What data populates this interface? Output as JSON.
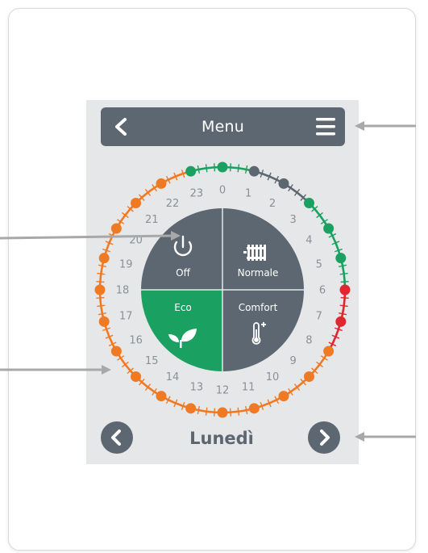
{
  "header": {
    "title": "Menu",
    "back_icon": "chevron-left-icon",
    "menu_icon": "hamburger-menu-icon"
  },
  "dial": {
    "hours": [
      "0",
      "1",
      "2",
      "3",
      "4",
      "5",
      "6",
      "7",
      "8",
      "9",
      "10",
      "11",
      "12",
      "13",
      "14",
      "15",
      "16",
      "17",
      "18",
      "19",
      "20",
      "21",
      "22",
      "23"
    ],
    "modes": [
      "normal",
      "off",
      "off",
      "normal",
      "normal",
      "normal",
      "comfort",
      "comfort",
      "eco",
      "eco",
      "eco",
      "eco",
      "eco",
      "eco",
      "eco",
      "eco",
      "eco",
      "eco",
      "eco",
      "eco",
      "eco",
      "eco",
      "eco",
      "normal"
    ],
    "mode_colors": {
      "normal": "#1aa162",
      "off": "#5d6771",
      "comfort": "#e0262e",
      "eco": "#f07a24"
    }
  },
  "mode_buttons": {
    "off": {
      "label": "Off",
      "icon": "power-icon",
      "color": "#5d6771"
    },
    "normal": {
      "label": "Normale",
      "icon": "radiator-icon",
      "color": "#5d6771"
    },
    "eco": {
      "label": "Eco",
      "icon": "leaf-icon",
      "color": "#1aa162"
    },
    "comfort": {
      "label": "Comfort",
      "icon": "thermometer-plus-icon",
      "color": "#5d6771"
    }
  },
  "day_nav": {
    "day": "Lunedì",
    "prev_icon": "chevron-left-icon",
    "next_icon": "chevron-right-icon"
  }
}
